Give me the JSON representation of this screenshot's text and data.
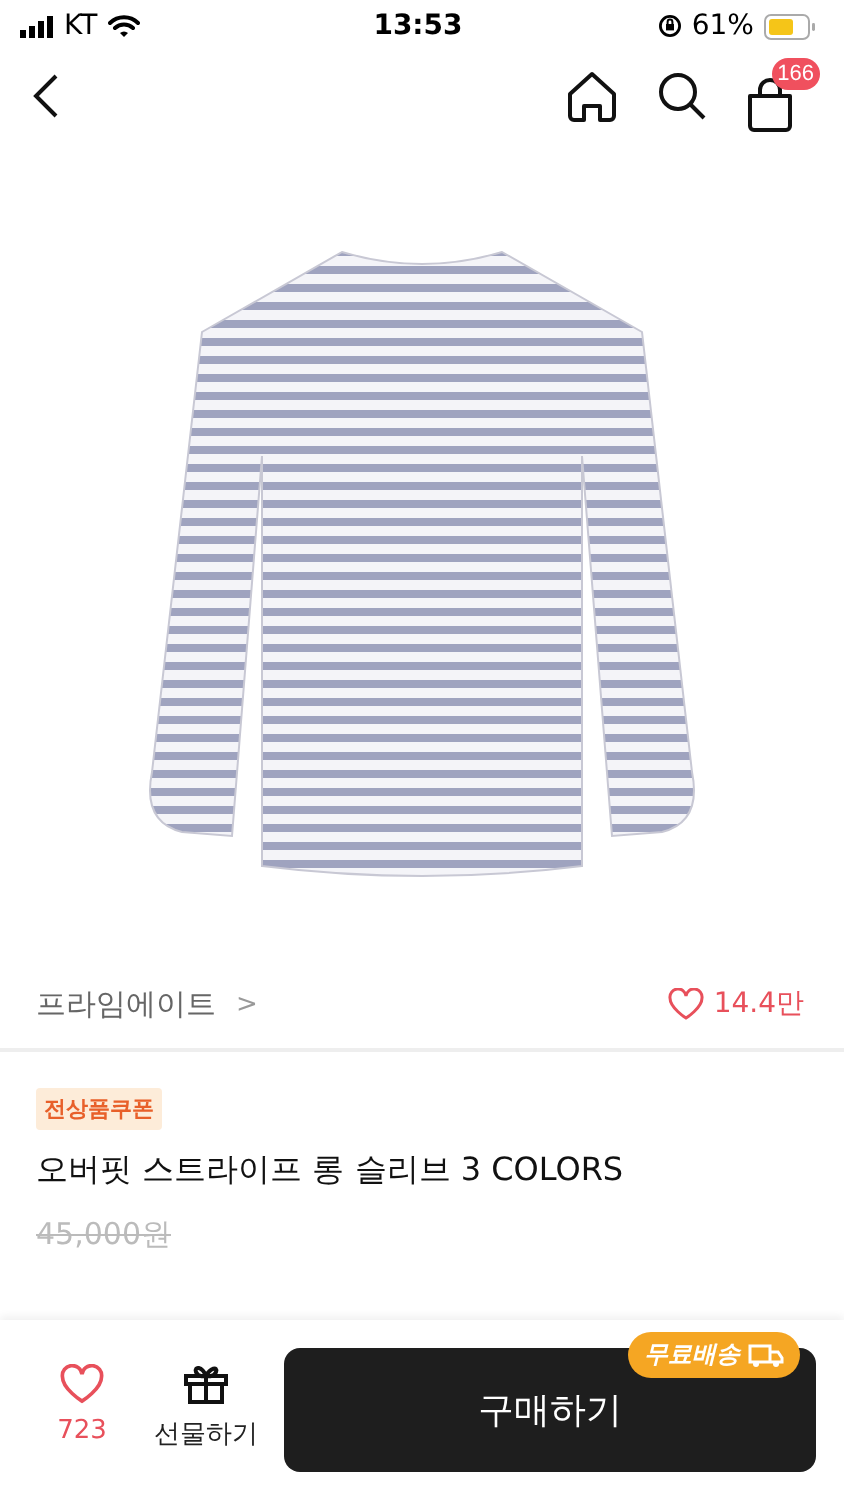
{
  "status_bar": {
    "carrier": "KT",
    "time": "13:53",
    "battery_percent": "61%"
  },
  "nav": {
    "cart_count": "166"
  },
  "brand": {
    "name": "프라임에이트",
    "chevron": ">",
    "likes": "14.4만"
  },
  "product": {
    "badge": "전상품쿠폰",
    "title": "오버핏 스트라이프 롱 슬리브 3 COLORS",
    "original_price": "45,000원"
  },
  "bottom_bar": {
    "like_count": "723",
    "gift_label": "선물하기",
    "buy_label": "구매하기",
    "shipping_badge": "무료배송"
  }
}
